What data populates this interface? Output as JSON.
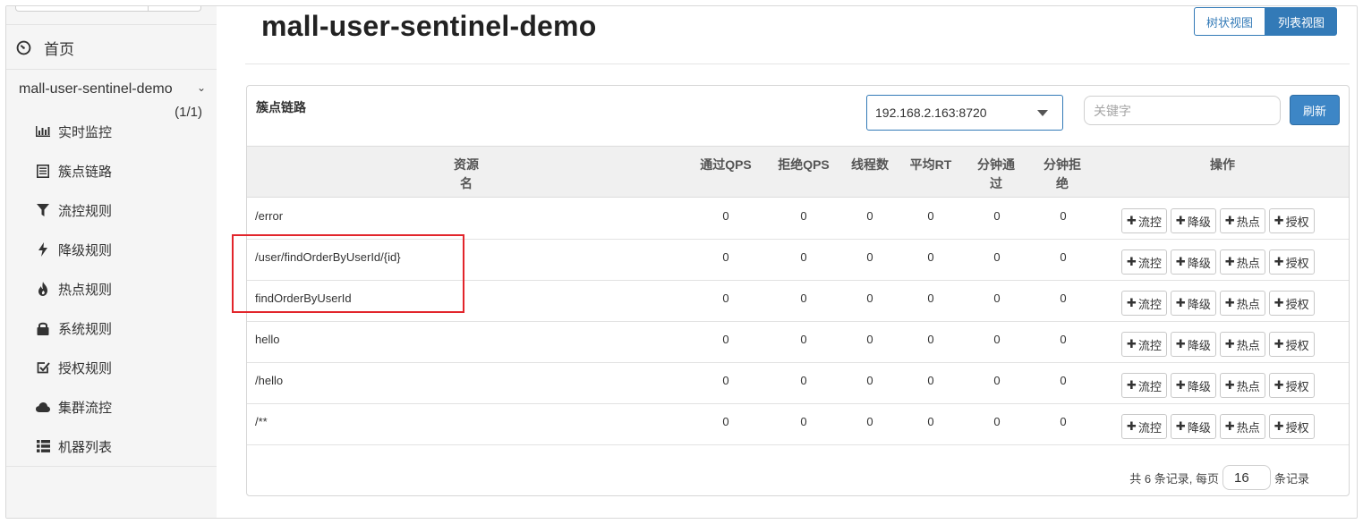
{
  "sidebar": {
    "home_label": "首页",
    "app_name": "mall-user-sentinel-demo",
    "app_count": "(1/1)",
    "items": [
      {
        "label": "实时监控",
        "icon": "bar-chart-icon"
      },
      {
        "label": "簇点链路",
        "icon": "list-alt-icon"
      },
      {
        "label": "流控规则",
        "icon": "filter-icon"
      },
      {
        "label": "降级规则",
        "icon": "flash-icon"
      },
      {
        "label": "热点规则",
        "icon": "fire-icon"
      },
      {
        "label": "系统规则",
        "icon": "lock-icon"
      },
      {
        "label": "授权规则",
        "icon": "check-icon"
      },
      {
        "label": "集群流控",
        "icon": "cloud-icon"
      },
      {
        "label": "机器列表",
        "icon": "th-list-icon"
      }
    ]
  },
  "header": {
    "title": "mall-user-sentinel-demo",
    "tree_view": "树状视图",
    "list_view": "列表视图"
  },
  "panel": {
    "title": "簇点链路",
    "machine": "192.168.2.163:8720",
    "keyword_placeholder": "关键字",
    "refresh": "刷新"
  },
  "table": {
    "headers": {
      "resource": "资源名",
      "pass_qps": "通过QPS",
      "block_qps": "拒绝QPS",
      "threads": "线程数",
      "avg_rt": "平均RT",
      "pass_min": "分钟通过",
      "block_min": "分钟拒绝",
      "ops": "操作"
    },
    "op_labels": {
      "flow": "流控",
      "degrade": "降级",
      "hot": "热点",
      "auth": "授权"
    },
    "rows": [
      {
        "name": "/error",
        "v": [
          "0",
          "0",
          "0",
          "0",
          "0",
          "0"
        ]
      },
      {
        "name": "/user/findOrderByUserId/{id}",
        "v": [
          "0",
          "0",
          "0",
          "0",
          "0",
          "0"
        ]
      },
      {
        "name": "findOrderByUserId",
        "v": [
          "0",
          "0",
          "0",
          "0",
          "0",
          "0"
        ]
      },
      {
        "name": "hello",
        "v": [
          "0",
          "0",
          "0",
          "0",
          "0",
          "0"
        ]
      },
      {
        "name": "/hello",
        "v": [
          "0",
          "0",
          "0",
          "0",
          "0",
          "0"
        ]
      },
      {
        "name": "/**",
        "v": [
          "0",
          "0",
          "0",
          "0",
          "0",
          "0"
        ]
      }
    ]
  },
  "pager": {
    "summary": "共 6 条记录, 每页",
    "page_size": "16",
    "suffix": "条记录"
  },
  "colors": {
    "primary": "#337ab7",
    "highlight": "#e2252b"
  }
}
